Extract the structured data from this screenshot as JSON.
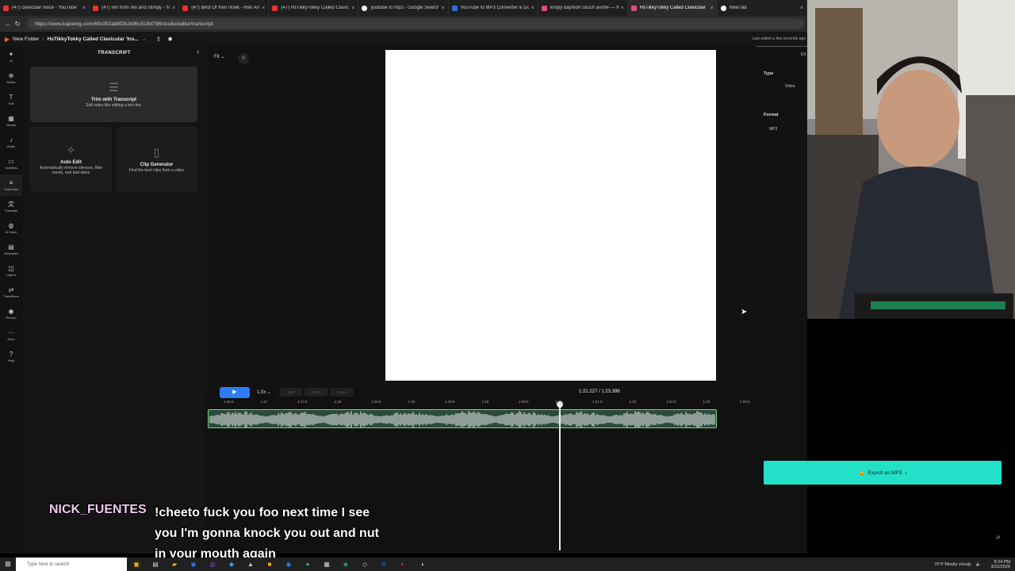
{
  "browser": {
    "tabs": [
      {
        "title": "(47) clavicular voice - YouTube",
        "icon": "youtube-icon"
      },
      {
        "title": "(47) ren from ren and stimpy - YouTube",
        "icon": "youtube-icon"
      },
      {
        "title": "(47) Best Of Ren Höek - Ren And Stimpy",
        "icon": "youtube-icon"
      },
      {
        "title": "(47) HsTikkyTokky Called Clavicular",
        "icon": "youtube-icon"
      },
      {
        "title": "youtube to mp3 - Google Search",
        "icon": "google-icon"
      },
      {
        "title": "YouTube to MP3 Converter & Download",
        "icon": "converter-icon"
      },
      {
        "title": "krispy daymon couch anime — Kapwing",
        "icon": "kapwing-icon"
      },
      {
        "title": "HsTikkyTokky Called Clavicular",
        "icon": "kapwing-icon"
      },
      {
        "title": "New tab",
        "icon": "newtab-icon"
      }
    ],
    "active_tab": 7,
    "url": "https://www.kapwing.com/69c092ab8f2b2b9bc519d798/studio/editor/transcript"
  },
  "app_header": {
    "folder": "New Folder",
    "project": "HsTikkyTokky Called Clavicular 'Ins...",
    "saved_status": "Last edited a few seconds ago"
  },
  "rail": [
    {
      "label": "AI",
      "icon": "sparkle-icon"
    },
    {
      "label": "Media",
      "icon": "plus-icon"
    },
    {
      "label": "Text",
      "icon": "text-icon"
    },
    {
      "label": "Visuals",
      "icon": "shapes-icon"
    },
    {
      "label": "Audio",
      "icon": "music-icon"
    },
    {
      "label": "Subtitles",
      "icon": "subtitles-icon"
    },
    {
      "label": "Transcript",
      "icon": "transcript-icon"
    },
    {
      "label": "Translate",
      "icon": "translate-icon"
    },
    {
      "label": "AI Voice",
      "icon": "mic-icon"
    },
    {
      "label": "Templates",
      "icon": "templates-icon"
    },
    {
      "label": "Layers",
      "icon": "layers-icon"
    },
    {
      "label": "Transitions",
      "icon": "transitions-icon"
    },
    {
      "label": "Record",
      "icon": "record-icon"
    },
    {
      "label": "More",
      "icon": "more-icon"
    },
    {
      "label": "Help",
      "icon": "help-icon"
    }
  ],
  "rail_active": "Transcript",
  "transcript_panel": {
    "title": "TRANSCRIPT",
    "trim_title": "Trim with Transcript",
    "trim_sub": "Edit video like editing a text doc",
    "auto_title": "Auto Edit",
    "auto_sub": "Automatically remove silences, filler words, and bad takes",
    "clip_title": "Clip Generator",
    "clip_sub": "Find the best clips from a video"
  },
  "stage": {
    "fit_label": "Fit"
  },
  "timeline": {
    "play_icon": "play-icon",
    "speed": "1.0x",
    "split_label": "Split",
    "delete_label": "Delete",
    "undo_label": "Undo",
    "timecode": "1:21.227 / 1:23.396",
    "ruler_ticks": [
      "1:16.5",
      "1:17",
      "1:17.5",
      "1:18",
      "1:18.5",
      "1:19",
      "1:19.5",
      "1:20",
      "1:20.5",
      "1:21",
      "1:21.5",
      "1:22",
      "1:22.5",
      "1:23",
      "1:23.5"
    ]
  },
  "export_panel": {
    "tab": "EX",
    "type_label": "Type",
    "type_value": "Video",
    "format_label": "Format",
    "format_value": "MP3",
    "export_button": "Export as MP3"
  },
  "chat": {
    "user": "NICK_FUENTES",
    "message": "!cheeto fuck you foo next time I see you I'm gonna knock you out and nut in your mouth again"
  },
  "taskbar": {
    "search_placeholder": "Type here to search",
    "weather": "70°F  Mostly cloudy",
    "time": "8:24 PM",
    "date": "3/22/2026"
  },
  "colors": {
    "accent_export": "#23e0c8",
    "play_button": "#2d7cf6",
    "waveform_track": "#2b4a3c",
    "chat_user": "#f0c9f0"
  }
}
